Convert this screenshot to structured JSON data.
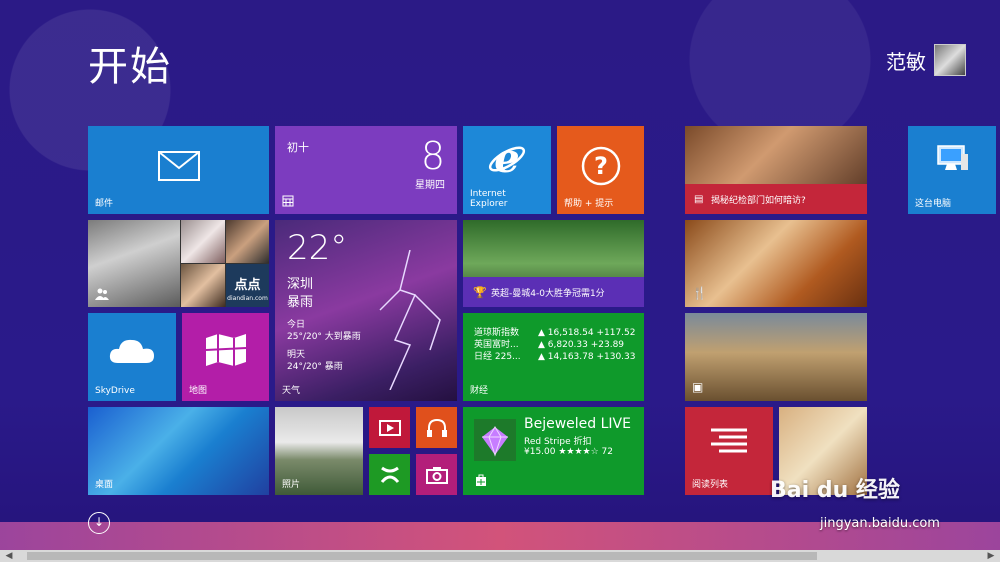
{
  "start": {
    "title": "开始",
    "user_name": "范敏"
  },
  "tiles": {
    "mail": {
      "label": "邮件"
    },
    "calendar": {
      "lunar": "初十",
      "day": "8",
      "weekday": "星期四"
    },
    "ie": {
      "label_line1": "Internet",
      "label_line2": "Explorer"
    },
    "help": {
      "label": "帮助 + 提示"
    },
    "people": {
      "brand": "点点",
      "brand_sub": "diandian.com"
    },
    "weather": {
      "temp": "22°",
      "city": "深圳",
      "condition": "暴雨",
      "today_label": "今日",
      "today": "25°/20° 大到暴雨",
      "tomorrow_label": "明天",
      "tomorrow": "24°/20° 暴雨",
      "label": "天气"
    },
    "sports": {
      "headline": "英超-曼城4-0大胜争冠需1分"
    },
    "skydrive": {
      "label": "SkyDrive"
    },
    "maps": {
      "label": "地图"
    },
    "finance": {
      "label": "财经",
      "rows": [
        {
          "name": "道琼斯指数",
          "value": "▲ 16,518.54 +117.52"
        },
        {
          "name": "英国富时...",
          "value": "▲ 6,820.33 +23.89"
        },
        {
          "name": "日经 225...",
          "value": "▲ 14,163.78 +130.33"
        }
      ]
    },
    "desktop": {
      "label": "桌面"
    },
    "photos": {
      "label": "照片"
    },
    "store": {
      "app_name": "Bejeweled LIVE",
      "publisher": "Red Stripe 折扣",
      "price": "¥15.00 ★★★★☆ 72"
    },
    "news": {
      "headline": "揭秘纪检部门如何暗访?"
    },
    "reading_list": {
      "label": "阅读列表"
    },
    "this_pc": {
      "label": "这台电脑"
    }
  },
  "watermark": {
    "brand": "Bai du 经验",
    "url": "jingyan.baidu.com"
  },
  "colors": {
    "background": "#2b1a86",
    "blue": "#1a7fd0",
    "purple": "#7c3cbf",
    "green": "#0f9a2b",
    "orange": "#e55a1c",
    "red": "#c4263a",
    "magenta": "#b31ea8"
  }
}
